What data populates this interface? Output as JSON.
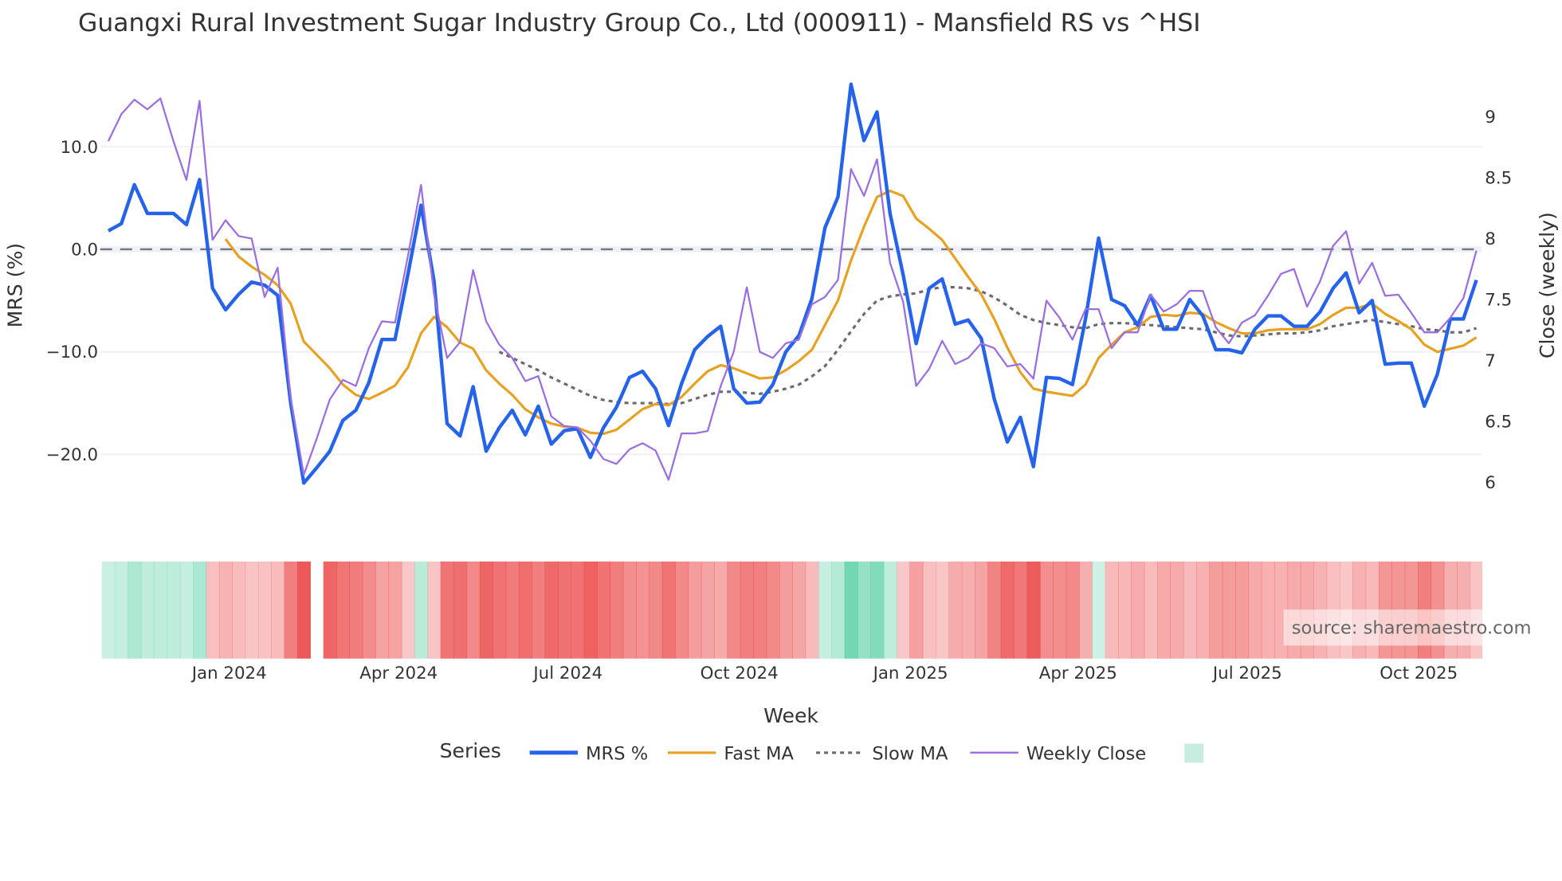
{
  "title": "Guangxi Rural Investment Sugar Industry Group Co., Ltd (000911) - Mansfield RS vs ^HSI",
  "source": "source: sharemaestro.com",
  "legend": {
    "title": "Series",
    "items": [
      {
        "label": "MRS %",
        "color": "#2563eb",
        "style": "solid"
      },
      {
        "label": "Fast MA",
        "color": "#e8a020",
        "style": "solid"
      },
      {
        "label": "Slow MA",
        "color": "#6b6b6b",
        "style": "dot"
      },
      {
        "label": "Weekly Close",
        "color": "#9b6fe0",
        "style": "solid"
      }
    ],
    "swatch_color": "#c6ede0"
  },
  "chart_data": {
    "type": "line",
    "title": "Guangxi Rural Investment Sugar Industry Group Co., Ltd (000911) - Mansfield RS vs ^HSI",
    "xlabel": "Week",
    "ylabel": "MRS (%)",
    "y2label": "Close (weekly)",
    "x_start": "2023-10-28",
    "x_frequency": "weekly",
    "x_ticks": [
      {
        "date": "2024-01-01",
        "label": "Jan 2024"
      },
      {
        "date": "2024-04-01",
        "label": "Apr 2024"
      },
      {
        "date": "2024-07-01",
        "label": "Jul 2024"
      },
      {
        "date": "2024-10-01",
        "label": "Oct 2024"
      },
      {
        "date": "2025-01-01",
        "label": "Jan 2025"
      },
      {
        "date": "2025-04-01",
        "label": "Apr 2025"
      },
      {
        "date": "2025-07-01",
        "label": "Jul 2025"
      },
      {
        "date": "2025-10-01",
        "label": "Oct 2025"
      }
    ],
    "y_ticks": [
      {
        "v": 10,
        "label": "10.0"
      },
      {
        "v": 0,
        "label": "0.0"
      },
      {
        "v": -10,
        "label": "−10.0"
      },
      {
        "v": -20,
        "label": "−20.0"
      }
    ],
    "y2_ticks": [
      {
        "v": 9,
        "label": "9"
      },
      {
        "v": 8.5,
        "label": "8.5"
      },
      {
        "v": 8,
        "label": "8"
      },
      {
        "v": 7.5,
        "label": "7.5"
      },
      {
        "v": 7,
        "label": "7"
      },
      {
        "v": 6.5,
        "label": "6.5"
      },
      {
        "v": 6,
        "label": "6"
      }
    ],
    "ylim": [
      -24.5,
      16.5
    ],
    "y2lim": [
      5.85,
      9.3
    ],
    "reference_line": 0,
    "series": [
      {
        "name": "MRS %",
        "axis": "y",
        "offset": 0,
        "values": [
          1.8,
          2.5,
          6.3,
          3.5,
          3.5,
          3.5,
          2.4,
          6.8,
          -3.8,
          -5.9,
          -4.4,
          -3.2,
          -3.5,
          -4.5,
          -15,
          -22.8,
          -21.3,
          -19.7,
          -16.7,
          -15.7,
          -13,
          -8.8,
          -8.8,
          -2.4,
          4.3,
          -3.1,
          -17,
          -18.2,
          -13.4,
          -19.7,
          -17.4,
          -15.7,
          -18.1,
          -15.3,
          -19,
          -17.7,
          -17.5,
          -20.3,
          -17.4,
          -15.4,
          -12.5,
          -11.9,
          -13.6,
          -17.2,
          -13.1,
          -9.8,
          -8.5,
          -7.5,
          -13.6,
          -15,
          -14.9,
          -13.2,
          -10,
          -8.4,
          -4.8,
          2.1,
          5.1,
          16.1,
          10.6,
          13.4,
          3.5,
          -2.5,
          -9.2,
          -3.8,
          -2.9,
          -7.3,
          -6.9,
          -8.7,
          -14.6,
          -18.8,
          -16.4,
          -21.2,
          -12.5,
          -12.6,
          -13.2,
          -6.8,
          1.1,
          -4.9,
          -5.5,
          -7.4,
          -4.5,
          -7.8,
          -7.8,
          -4.9,
          -6.5,
          -9.8,
          -9.8,
          -10.1,
          -7.8,
          -6.5,
          -6.5,
          -7.5,
          -7.5,
          -6.1,
          -3.8,
          -2.3,
          -6.2,
          -5,
          -11.2,
          -11.1,
          -11.1,
          -15.3,
          -12.2,
          -6.8,
          -6.8,
          -3
        ]
      },
      {
        "name": "Fast MA",
        "axis": "y",
        "offset": 9,
        "values": [
          1.0,
          -0.7,
          -1.7,
          -2.5,
          -3.5,
          -5.3,
          -9,
          -10.3,
          -11.6,
          -13.2,
          -14.2,
          -14.6,
          -14,
          -13.3,
          -11.5,
          -8.2,
          -6.6,
          -7.6,
          -9.1,
          -9.7,
          -11.8,
          -13.1,
          -14.2,
          -15.6,
          -16.4,
          -17,
          -17.3,
          -17.4,
          -17.9,
          -18,
          -17.6,
          -16.6,
          -15.6,
          -15.1,
          -15.2,
          -14.4,
          -13.1,
          -11.9,
          -11.3,
          -11.6,
          -12.1,
          -12.6,
          -12.5,
          -11.8,
          -10.9,
          -9.8,
          -7.4,
          -5,
          -1.1,
          2.2,
          5.1,
          5.7,
          5.2,
          3,
          2,
          0.9,
          -0.9,
          -2.7,
          -4.4,
          -6.8,
          -9.6,
          -12,
          -13.6,
          -13.9,
          -14.1,
          -14.3,
          -13.2,
          -10.6,
          -9.3,
          -8.1,
          -7.6,
          -6.6,
          -6.4,
          -6.5,
          -6.2,
          -6.3,
          -7.1,
          -7.7,
          -8.2,
          -8.2,
          -7.9,
          -7.8,
          -7.8,
          -7.8,
          -7.3,
          -6.4,
          -5.7,
          -5.7,
          -5.3,
          -6.3,
          -7,
          -7.8,
          -9.3,
          -10,
          -9.7,
          -9.4,
          -8.6
        ]
      },
      {
        "name": "Slow MA",
        "axis": "y",
        "offset": 30,
        "values": [
          -10,
          -10.6,
          -11.2,
          -11.8,
          -12.5,
          -13.1,
          -13.7,
          -14.3,
          -14.7,
          -14.9,
          -15,
          -15,
          -15,
          -15.1,
          -15,
          -14.6,
          -14.2,
          -13.9,
          -13.9,
          -14,
          -14.1,
          -13.9,
          -13.6,
          -13.2,
          -12.4,
          -11.4,
          -9.8,
          -8,
          -6.3,
          -5,
          -4.6,
          -4.4,
          -4.3,
          -3.9,
          -3.7,
          -3.7,
          -3.8,
          -4.1,
          -4.7,
          -5.5,
          -6.4,
          -6.9,
          -7.2,
          -7.4,
          -7.6,
          -7.7,
          -7.3,
          -7.2,
          -7.2,
          -7.3,
          -7.4,
          -7.5,
          -7.6,
          -7.7,
          -7.8,
          -8.1,
          -8.4,
          -8.5,
          -8.4,
          -8.3,
          -8.2,
          -8.2,
          -8.1,
          -7.9,
          -7.5,
          -7.3,
          -7.1,
          -6.9,
          -7.1,
          -7.3,
          -7.5,
          -7.8,
          -7.9,
          -8.1,
          -8.1,
          -7.7
        ]
      },
      {
        "name": "Weekly Close",
        "axis": "y2",
        "offset": 0,
        "values": [
          8.8,
          9.02,
          9.14,
          9.06,
          9.15,
          8.8,
          8.48,
          9.13,
          7.99,
          8.15,
          8.02,
          8.0,
          7.52,
          7.76,
          6.69,
          6.06,
          6.36,
          6.68,
          6.84,
          6.79,
          7.1,
          7.32,
          7.31,
          7.86,
          8.44,
          7.54,
          7.02,
          7.15,
          7.74,
          7.32,
          7.13,
          7.02,
          6.83,
          6.87,
          6.54,
          6.46,
          6.45,
          6.34,
          6.19,
          6.15,
          6.27,
          6.32,
          6.26,
          6.02,
          6.4,
          6.4,
          6.42,
          6.79,
          7.07,
          7.6,
          7.07,
          7.02,
          7.14,
          7.17,
          7.46,
          7.52,
          7.66,
          8.57,
          8.35,
          8.65,
          7.8,
          7.48,
          6.79,
          6.93,
          7.16,
          6.97,
          7.02,
          7.14,
          7.1,
          6.95,
          6.97,
          6.85,
          7.49,
          7.35,
          7.17,
          7.42,
          7.42,
          7.1,
          7.23,
          7.23,
          7.54,
          7.4,
          7.46,
          7.57,
          7.57,
          7.27,
          7.14,
          7.31,
          7.37,
          7.53,
          7.71,
          7.75,
          7.44,
          7.65,
          7.94,
          8.06,
          7.63,
          7.8,
          7.53,
          7.54,
          7.39,
          7.23,
          7.23,
          7.35,
          7.51,
          7.9
        ]
      }
    ],
    "regime_strip": {
      "based_on": "MRS %",
      "missing_weeks": [
        16
      ],
      "positive_color": "#3cc896",
      "negative_color": "#eb4646"
    }
  }
}
